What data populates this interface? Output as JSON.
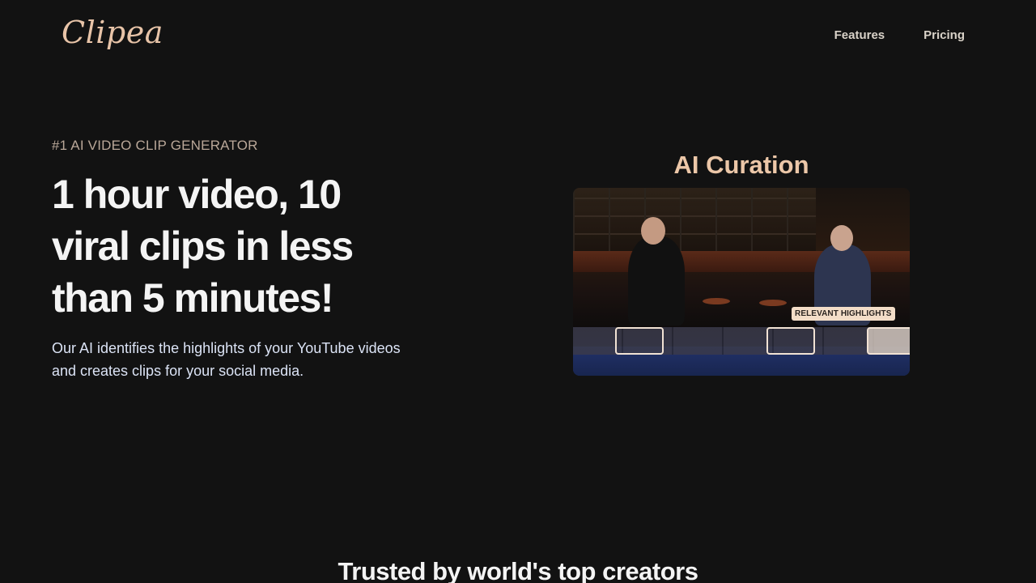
{
  "brand": {
    "logo": "Clipea"
  },
  "nav": {
    "features": "Features",
    "pricing": "Pricing"
  },
  "hero": {
    "eyebrow": "#1 AI VIDEO CLIP GENERATOR",
    "headline": "1 hour video, 10 viral clips in less than 5 minutes!",
    "subtext": "Our AI identifies the highlights of your YouTube videos and creates clips for your social media."
  },
  "demo": {
    "title": "AI Curation",
    "badge": "RELEVANT HIGHLIGHTS"
  },
  "trusted": {
    "title": "Trusted by world's top creators"
  },
  "colors": {
    "background": "#121212",
    "accent": "#ecc7a8"
  }
}
